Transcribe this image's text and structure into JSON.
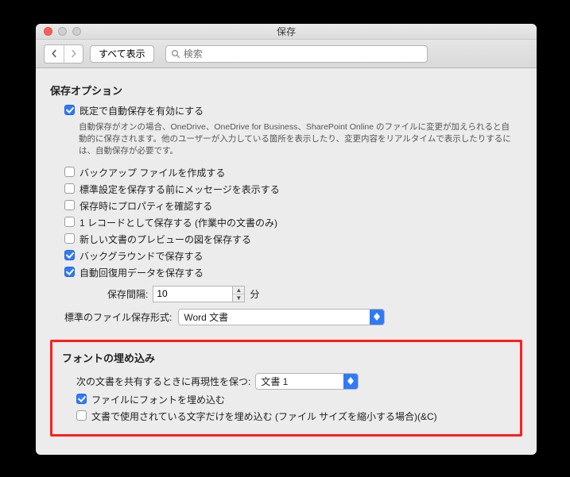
{
  "window": {
    "title": "保存"
  },
  "toolbar": {
    "showAllLabel": "すべて表示",
    "searchPlaceholder": "検索"
  },
  "saveOptions": {
    "title": "保存オプション",
    "autosave": {
      "checked": true,
      "label": "既定で自動保存を有効にする"
    },
    "autosaveHelp": "自動保存がオンの場合、OneDrive、OneDrive for Business、SharePoint Online のファイルに変更が加えられると自動的に保存されます。他のユーザーが入力している箇所を表示したり、変更内容をリアルタイムで表示したりするには、自動保存が必要です。",
    "backup": {
      "checked": false,
      "label": "バックアップ ファイルを作成する"
    },
    "promptSaveNormal": {
      "checked": false,
      "label": "標準設定を保存する前にメッセージを表示する"
    },
    "promptProperties": {
      "checked": false,
      "label": "保存時にプロパティを確認する"
    },
    "saveRecord": {
      "checked": false,
      "label": "1 レコードとして保存する (作業中の文書のみ)"
    },
    "savePreview": {
      "checked": false,
      "label": "新しい文書のプレビューの図を保存する"
    },
    "backgroundSave": {
      "checked": true,
      "label": "バックグラウンドで保存する"
    },
    "autoRecover": {
      "checked": true,
      "label": "自動回復用データを保存する"
    },
    "intervalLabel": "保存間隔:",
    "intervalValue": "10",
    "intervalUnit": "分",
    "defaultFormatLabel": "標準のファイル保存形式:",
    "defaultFormatValue": "Word 文書"
  },
  "fontEmbed": {
    "title": "フォントの埋め込み",
    "shareLabel": "次の文書を共有するときに再現性を保つ:",
    "shareDocValue": "文書 1",
    "embedFonts": {
      "checked": true,
      "label": "ファイルにフォントを埋め込む"
    },
    "embedSubset": {
      "checked": false,
      "label": "文書で使用されている文字だけを埋め込む (ファイル サイズを縮小する場合)(&C)"
    }
  }
}
